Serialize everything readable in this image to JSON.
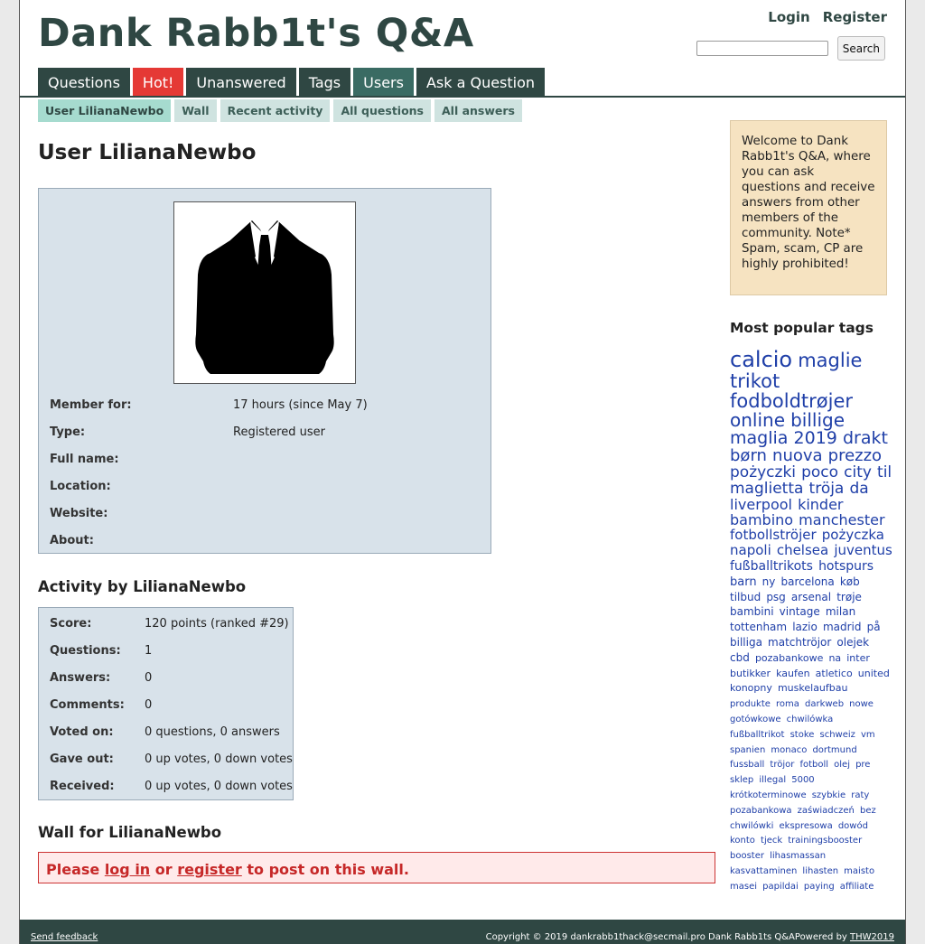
{
  "site": {
    "logo": "Dank Rabb1t's Q&A"
  },
  "auth": {
    "login": "Login",
    "register": "Register"
  },
  "search": {
    "button": "Search",
    "placeholder": ""
  },
  "nav": [
    "Questions",
    "Hot!",
    "Unanswered",
    "Tags",
    "Users",
    "Ask a Question"
  ],
  "subnav": [
    "User LilianaNewbo",
    "Wall",
    "Recent activity",
    "All questions",
    "All answers"
  ],
  "page_title": "User LilianaNewbo",
  "profile": {
    "rows": [
      {
        "label": "Member for:",
        "value": "17 hours (since May 7)"
      },
      {
        "label": "Type:",
        "value": "Registered user"
      },
      {
        "label": "Full name:",
        "value": ""
      },
      {
        "label": "Location:",
        "value": ""
      },
      {
        "label": "Website:",
        "value": ""
      },
      {
        "label": "About:",
        "value": ""
      }
    ]
  },
  "activity": {
    "heading": "Activity by LilianaNewbo",
    "rows": [
      {
        "label": "Score:",
        "value": "120 points (ranked #29)"
      },
      {
        "label": "Questions:",
        "value": "1"
      },
      {
        "label": "Answers:",
        "value": "0"
      },
      {
        "label": "Comments:",
        "value": "0"
      },
      {
        "label": "Voted on:",
        "value": "0 questions, 0 answers"
      },
      {
        "label": "Gave out:",
        "value": "0 up votes, 0 down votes"
      },
      {
        "label": "Received:",
        "value": "0 up votes, 0 down votes"
      }
    ]
  },
  "wall": {
    "heading": "Wall for LilianaNewbo",
    "pre": "Please ",
    "login": "log in",
    "mid": " or ",
    "register": "register",
    "post": " to post on this wall."
  },
  "sidebar": {
    "welcome": "Welcome to Dank Rabb1t's Q&A, where you can ask questions and receive answers from other members of the community. Note* Spam, scam, CP are highly prohibited!",
    "popular_heading": "Most popular tags",
    "tags": [
      {
        "t": "calcio",
        "s": 24
      },
      {
        "t": "maglie",
        "s": 21
      },
      {
        "t": "trikot",
        "s": 21
      },
      {
        "t": "fodboldtrøjer",
        "s": 21
      },
      {
        "t": "online",
        "s": 20
      },
      {
        "t": "billige",
        "s": 20
      },
      {
        "t": "maglia",
        "s": 19
      },
      {
        "t": "2019",
        "s": 19
      },
      {
        "t": "drakt",
        "s": 19
      },
      {
        "t": "børn",
        "s": 18
      },
      {
        "t": "nuova",
        "s": 18
      },
      {
        "t": "prezzo",
        "s": 18
      },
      {
        "t": "pożyczki",
        "s": 17
      },
      {
        "t": "poco",
        "s": 17
      },
      {
        "t": "city",
        "s": 17
      },
      {
        "t": "til",
        "s": 17
      },
      {
        "t": "maglietta",
        "s": 17
      },
      {
        "t": "tröja",
        "s": 17
      },
      {
        "t": "da",
        "s": 17
      },
      {
        "t": "liverpool",
        "s": 16
      },
      {
        "t": "kinder",
        "s": 16
      },
      {
        "t": "bambino",
        "s": 16
      },
      {
        "t": "manchester",
        "s": 16
      },
      {
        "t": "fotbollströjer",
        "s": 15
      },
      {
        "t": "pożyczka",
        "s": 15
      },
      {
        "t": "napoli",
        "s": 15
      },
      {
        "t": "chelsea",
        "s": 15
      },
      {
        "t": "juventus",
        "s": 15
      },
      {
        "t": "fußballtrikots",
        "s": 14
      },
      {
        "t": "hotspurs",
        "s": 14
      },
      {
        "t": "barn",
        "s": 13
      },
      {
        "t": "ny",
        "s": 12
      },
      {
        "t": "barcelona",
        "s": 12
      },
      {
        "t": "køb",
        "s": 12
      },
      {
        "t": "tilbud",
        "s": 12
      },
      {
        "t": "psg",
        "s": 12
      },
      {
        "t": "arsenal",
        "s": 12
      },
      {
        "t": "trøje",
        "s": 12
      },
      {
        "t": "bambini",
        "s": 12
      },
      {
        "t": "vintage",
        "s": 12
      },
      {
        "t": "milan",
        "s": 12
      },
      {
        "t": "tottenham",
        "s": 12
      },
      {
        "t": "lazio",
        "s": 12
      },
      {
        "t": "madrid",
        "s": 12
      },
      {
        "t": "på",
        "s": 12
      },
      {
        "t": "billiga",
        "s": 12
      },
      {
        "t": "matchtröjor",
        "s": 12
      },
      {
        "t": "olejek",
        "s": 12
      },
      {
        "t": "cbd",
        "s": 12
      },
      {
        "t": "pozabankowe",
        "s": 11
      },
      {
        "t": "na",
        "s": 11
      },
      {
        "t": "inter",
        "s": 11
      },
      {
        "t": "butikker",
        "s": 11
      },
      {
        "t": "kaufen",
        "s": 11
      },
      {
        "t": "atletico",
        "s": 11
      },
      {
        "t": "united",
        "s": 11
      },
      {
        "t": "konopny",
        "s": 11
      },
      {
        "t": "muskelaufbau",
        "s": 11
      },
      {
        "t": "produkte",
        "s": 10
      },
      {
        "t": "roma",
        "s": 10
      },
      {
        "t": "darkweb",
        "s": 10
      },
      {
        "t": "nowe",
        "s": 10
      },
      {
        "t": "gotówkowe",
        "s": 10
      },
      {
        "t": "chwilówka",
        "s": 10
      },
      {
        "t": "fußballtrikot",
        "s": 10
      },
      {
        "t": "stoke",
        "s": 10
      },
      {
        "t": "schweiz",
        "s": 10
      },
      {
        "t": "vm",
        "s": 10
      },
      {
        "t": "spanien",
        "s": 10
      },
      {
        "t": "monaco",
        "s": 10
      },
      {
        "t": "dortmund",
        "s": 10
      },
      {
        "t": "fussball",
        "s": 10
      },
      {
        "t": "tröjor",
        "s": 10
      },
      {
        "t": "fotboll",
        "s": 10
      },
      {
        "t": "olej",
        "s": 10
      },
      {
        "t": "pre",
        "s": 10
      },
      {
        "t": "sklep",
        "s": 10
      },
      {
        "t": "illegal",
        "s": 10
      },
      {
        "t": "5000",
        "s": 10
      },
      {
        "t": "krótkoterminowe",
        "s": 10
      },
      {
        "t": "szybkie",
        "s": 10
      },
      {
        "t": "raty",
        "s": 10
      },
      {
        "t": "pozabankowa",
        "s": 10
      },
      {
        "t": "zaświadczeń",
        "s": 10
      },
      {
        "t": "bez",
        "s": 10
      },
      {
        "t": "chwilówki",
        "s": 10
      },
      {
        "t": "ekspresowa",
        "s": 10
      },
      {
        "t": "dowód",
        "s": 10
      },
      {
        "t": "konto",
        "s": 10
      },
      {
        "t": "tjeck",
        "s": 10
      },
      {
        "t": "trainingsbooster",
        "s": 10
      },
      {
        "t": "booster",
        "s": 10
      },
      {
        "t": "lihasmassan",
        "s": 10
      },
      {
        "t": "kasvattaminen",
        "s": 10
      },
      {
        "t": "lihasten",
        "s": 10
      },
      {
        "t": "maisto",
        "s": 10
      },
      {
        "t": "masei",
        "s": 10
      },
      {
        "t": "papildai",
        "s": 10
      },
      {
        "t": "paying",
        "s": 10
      },
      {
        "t": "affiliate",
        "s": 10
      }
    ]
  },
  "footer": {
    "feedback": "Send feedback",
    "copyright": "Copyright © 2019 dankrabb1thack@secmail.pro Dank Rabb1ts Q&A",
    "powered": "Powered by ",
    "powered_link": "THW2019"
  }
}
